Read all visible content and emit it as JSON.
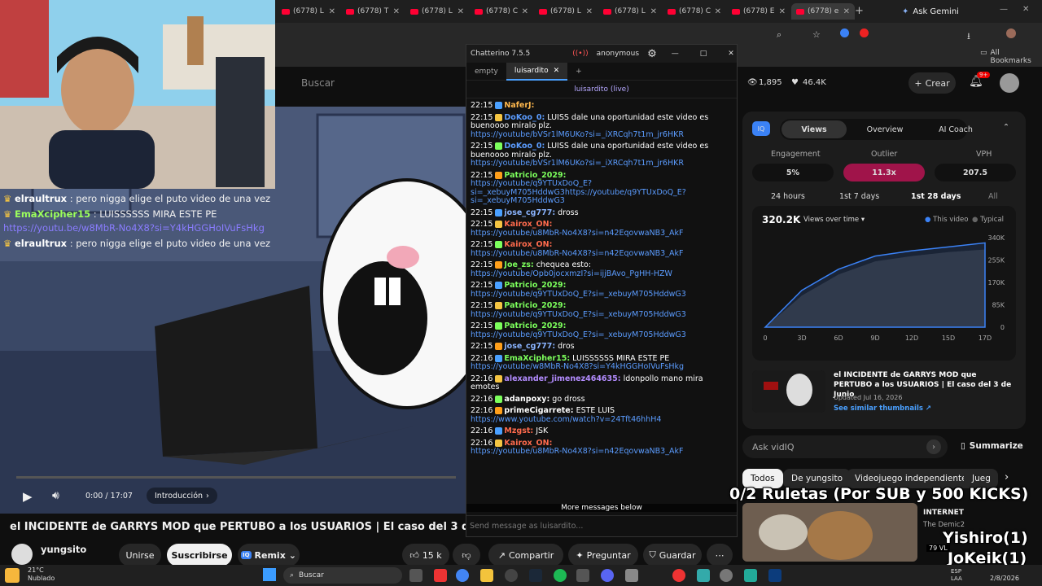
{
  "browser": {
    "tabs": [
      "(6778) L",
      "(6778) T",
      "(6778) L",
      "(6778) C",
      "(6778) L",
      "(6778) L",
      "(6778) C",
      "(6778) E",
      "(6778) e"
    ],
    "ask_gemini": "Ask Gemini",
    "all_bookmarks": "All Bookmarks"
  },
  "youtube": {
    "search_placeholder": "Buscar",
    "video_title": "el INCIDENTE de GARRYS MOD que PERTUBO a los USUARIOS | El caso del 3 de Junio",
    "time": "0:00 / 17:07",
    "chapter": "Introducción",
    "channel": "yungsito",
    "join": "Unirse",
    "subscribe": "Suscribirse",
    "remix": "Remix",
    "likes": "15 k",
    "share": "Compartir",
    "ask": "Preguntar",
    "save": "Guardar",
    "create": "Crear",
    "notif_count": "9+"
  },
  "stream_chat": [
    {
      "user": "elraultrux",
      "text": ": pero nigga elige el puto video de una vez",
      "green": false
    },
    {
      "user": "EmaXcipher15",
      "text": ": LUISSSSSS MIRA ESTE PE",
      "link": "https://youtu.be/w8MbR-No4X8?si=Y4kHGGHoIVuFsHkg",
      "green": true
    },
    {
      "user": "elraultrux",
      "text": ": pero nigga elige el puto video de una vez",
      "green": false
    }
  ],
  "chatterino": {
    "title": "Chatterino 7.5.5",
    "account": "anonymous",
    "tabs": [
      "empty",
      "luisardito"
    ],
    "channel": "luisardito (live)",
    "more_messages": "More messages below",
    "input_placeholder": "Send message as luisardito...",
    "messages": [
      {
        "time": "22:15",
        "user": "NaferJ:",
        "text": "",
        "color": "#ffb84d"
      },
      {
        "time": "22:15",
        "user": "DoKoo_0:",
        "text": " LUISS dale una oportunidad este video es buenoooo miralo plz.",
        "link": "https://youtube/bVSr1lM6UKo?si=_iXRCqh7t1m_jr6HKR",
        "color": "#5b9cff"
      },
      {
        "time": "22:15",
        "user": "DoKoo_0:",
        "text": " LUISS dale una oportunidad este video es buenoooo miralo plz.",
        "link": "https://youtube/bVSr1lM6UKo?si=_iXRCqh7t1m_jr6HKR",
        "color": "#5b9cff"
      },
      {
        "time": "22:15",
        "user": "Patricio_2029:",
        "text": "",
        "link": "https://youtube/q9YTUxDoQ_E?si=_xebuyM705HddwG3https://youtube/q9YTUxDoQ_E?si=_xebuyM705HddwG3",
        "color": "#7cff5c"
      },
      {
        "time": "22:15",
        "user": "jose_cg777:",
        "text": " dross",
        "color": "#8ab4ff"
      },
      {
        "time": "22:15",
        "user": "Kairox_ON:",
        "text": "",
        "link": "https://youtube/u8MbR-No4X8?si=n42EqovwaNB3_AkF",
        "color": "#ff6b4d"
      },
      {
        "time": "22:15",
        "user": "Kairox_ON:",
        "text": "",
        "link": "https://youtube/u8MbR-No4X8?si=n42EqovwaNB3_AkF",
        "color": "#ff6b4d"
      },
      {
        "time": "22:15",
        "user": "Joe_zs:",
        "text": " chequea esto:",
        "link": "https://youtube/Opb0jocxmzI?si=ijjBAvo_PgHH-HZW",
        "color": "#7cff5c"
      },
      {
        "time": "22:15",
        "user": "Patricio_2029:",
        "text": "",
        "link": "https://youtube/q9YTUxDoQ_E?si=_xebuyM705HddwG3",
        "color": "#7cff5c"
      },
      {
        "time": "22:15",
        "user": "Patricio_2029:",
        "text": "",
        "link": "https://youtube/q9YTUxDoQ_E?si=_xebuyM705HddwG3",
        "color": "#7cff5c"
      },
      {
        "time": "22:15",
        "user": "Patricio_2029:",
        "text": "",
        "link": "https://youtube/q9YTUxDoQ_E?si=_xebuyM705HddwG3",
        "color": "#7cff5c"
      },
      {
        "time": "22:15",
        "user": "jose_cg777:",
        "text": " dros",
        "color": "#8ab4ff"
      },
      {
        "time": "22:16",
        "user": "EmaXcipher15:",
        "text": " LUISSSSSS MIRA ESTE PE",
        "link": "https://youtube/w8MbR-No4X8?si=Y4kHGGHoIVuFsHkg",
        "color": "#7cff5c"
      },
      {
        "time": "22:16",
        "user": "alexander_jimenez464635:",
        "text": " ldonpollo mano mira emotes",
        "color": "#b38cff"
      },
      {
        "time": "22:16",
        "user": "adanpoxy:",
        "text": " go dross",
        "color": "#ffffff"
      },
      {
        "time": "22:16",
        "user": "primeCigarrete:",
        "text": " ESTE LUIS",
        "link": "https://www.youtube.com/watch?v=24Tft46hhH4",
        "color": "#ffffff"
      },
      {
        "time": "22:16",
        "user": "Mzgst:",
        "text": " JSK",
        "color": "#ff6b4d"
      },
      {
        "time": "22:16",
        "user": "Kairox_ON:",
        "text": "",
        "link": "https://youtube/u8MbR-No4X8?si=n42EqovwaNB3_AkF",
        "color": "#ff6b4d"
      }
    ]
  },
  "stats": {
    "views": "1,895",
    "likes": "46.4K"
  },
  "vidiq": {
    "tabs": [
      "Views",
      "Overview",
      "AI Coach"
    ],
    "metrics": [
      {
        "label": "Engagement",
        "value": "5%"
      },
      {
        "label": "Outlier",
        "value": "11.3x"
      },
      {
        "label": "VPH",
        "value": "207.5"
      }
    ],
    "ranges": [
      "24 hours",
      "1st 7 days",
      "1st 28 days",
      "All"
    ],
    "total_views": "320.2K",
    "views_over_time": "Views over time",
    "legend": [
      "This video",
      "Typical"
    ],
    "video_card_title": "el INCIDENTE de GARRYS MOD que PERTUBO a los USUARIOS | El caso del 3 de Junio",
    "updated": "Updated Jul 16, 2026",
    "similar": "See similar thumbnails",
    "ask_placeholder": "Ask vidIQ",
    "summarize": "Summarize"
  },
  "chart_data": {
    "type": "area",
    "x": [
      "0",
      "3D",
      "6D",
      "9D",
      "12D",
      "15D",
      "17D"
    ],
    "yticks": [
      "0",
      "85K",
      "170K",
      "255K",
      "340K"
    ],
    "ylim": [
      0,
      340000
    ],
    "series": [
      {
        "name": "This video",
        "values": [
          0,
          140000,
          220000,
          270000,
          290000,
          305000,
          320200
        ],
        "color": "#3b82f6"
      },
      {
        "name": "Typical",
        "values": [
          0,
          120000,
          200000,
          250000,
          270000,
          285000,
          295000
        ],
        "color": "#555555"
      }
    ]
  },
  "chips": [
    "Todos",
    "De yungsito",
    "Videojuego independiente",
    "Jueg"
  ],
  "sidebar_video": {
    "label": "INTERNET",
    "channel": "The Demic2",
    "views": "79 VL"
  },
  "overlays": {
    "ruletas": "0/2 Ruletas (Por SUB y 500 KICKS)",
    "name1": "Yishiro(1)",
    "name2": "JoKeik(1)"
  },
  "taskbar": {
    "weather_temp": "21°C",
    "weather_desc": "Nublado",
    "search": "Buscar",
    "lang": "ESP\nLAA",
    "date": "2/8/2026"
  }
}
